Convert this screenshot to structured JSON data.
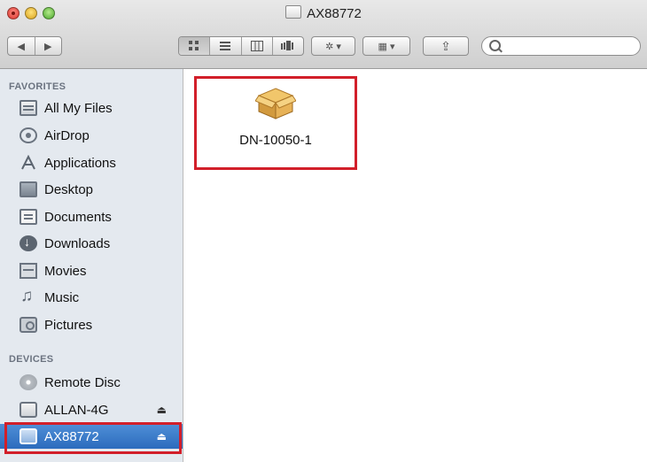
{
  "window": {
    "title": "AX88772"
  },
  "toolbar": {
    "nav": [
      "◀",
      "▶"
    ],
    "views": [
      "icon-view",
      "list-view",
      "column-view",
      "coverflow-view"
    ],
    "action_label": "✲ ▾",
    "arrange_label": "▦ ▾",
    "share_label": "⇪",
    "search_placeholder": ""
  },
  "sidebar": {
    "favorites_header": "FAVORITES",
    "favorites": [
      {
        "label": "All My Files",
        "icon": "all-my-files-icon"
      },
      {
        "label": "AirDrop",
        "icon": "airdrop-icon"
      },
      {
        "label": "Applications",
        "icon": "applications-icon"
      },
      {
        "label": "Desktop",
        "icon": "desktop-icon"
      },
      {
        "label": "Documents",
        "icon": "documents-icon"
      },
      {
        "label": "Downloads",
        "icon": "downloads-icon"
      },
      {
        "label": "Movies",
        "icon": "movies-icon"
      },
      {
        "label": "Music",
        "icon": "music-icon"
      },
      {
        "label": "Pictures",
        "icon": "pictures-icon"
      }
    ],
    "devices_header": "DEVICES",
    "devices": [
      {
        "label": "Remote Disc",
        "icon": "remote-disc-icon"
      },
      {
        "label": "ALLAN-4G",
        "icon": "drive-icon",
        "eject": "⏏"
      },
      {
        "label": "AX88772",
        "icon": "drive-icon",
        "eject": "⏏",
        "selected": true
      }
    ]
  },
  "main": {
    "files": [
      {
        "name": "DN-10050-1",
        "icon": "package-icon"
      }
    ]
  },
  "colors": {
    "highlight": "#d21f2a",
    "selection": "#2c6bbd",
    "sidebar_bg": "#e4e9ef"
  }
}
